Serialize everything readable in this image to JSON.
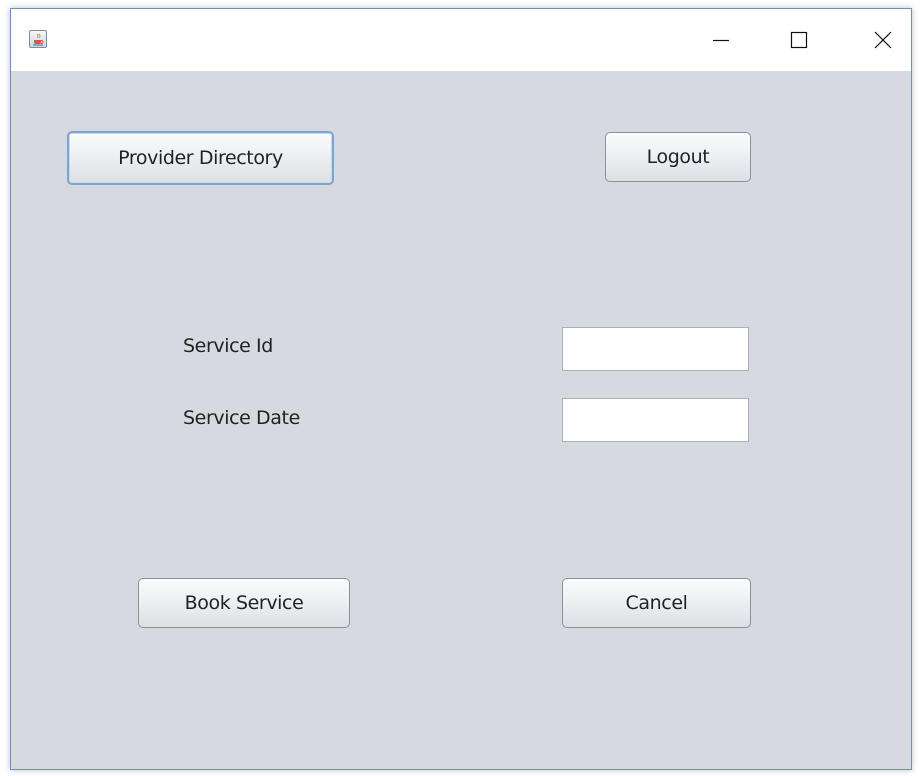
{
  "window": {
    "icon": "java-cup-icon",
    "controls": [
      "minimize-icon",
      "maximize-icon",
      "close-icon"
    ]
  },
  "toolbar": {
    "provider_directory_label": "Provider Directory",
    "logout_label": "Logout"
  },
  "form": {
    "service_id_label": "Service Id",
    "service_id_value": "",
    "service_date_label": "Service Date",
    "service_date_value": ""
  },
  "actions": {
    "book_label": "Book Service",
    "cancel_label": "Cancel"
  },
  "colors": {
    "panel_background": "#d6d9e0",
    "focus_border": "#7ea4cf",
    "window_border": "#6f8fb3"
  }
}
